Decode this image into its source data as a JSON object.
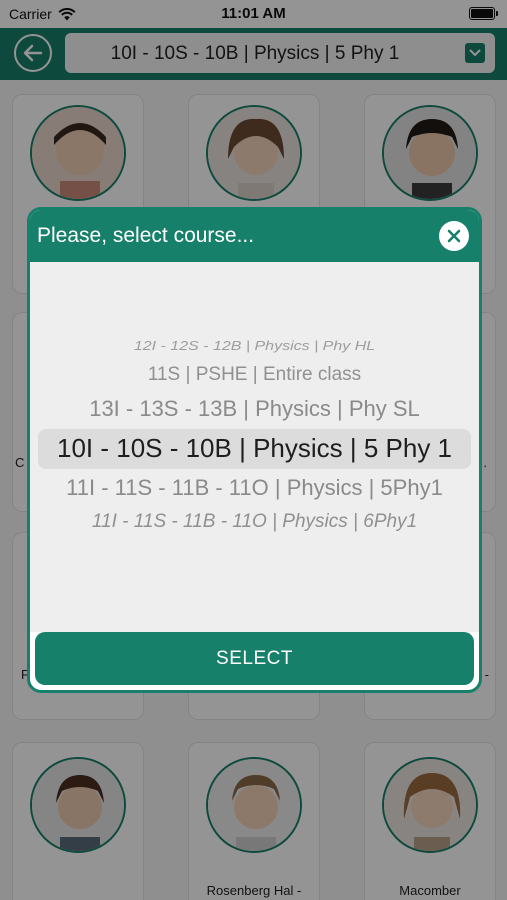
{
  "status_bar": {
    "carrier": "Carrier",
    "time": "11:01 AM"
  },
  "header": {
    "course_selected": "10I - 10S - 10B  | Physics | 5 Phy 1"
  },
  "students": [
    {
      "name": ""
    },
    {
      "name": ""
    },
    {
      "name": ""
    },
    {
      "name": "C"
    },
    {
      "name": ""
    },
    {
      "name": "."
    },
    {
      "name": "F"
    },
    {
      "name": ""
    },
    {
      "name": "-"
    },
    {
      "name": ""
    },
    {
      "name": "Rosenberg Hal -"
    },
    {
      "name": "Macomber"
    }
  ],
  "modal": {
    "title": "Please, select course...",
    "options": [
      "12I - 12S - 12B  | Physics | Phy HL",
      "11S  | PSHE | Entire class",
      "13I - 13S - 13B  | Physics | Phy SL",
      "10I - 10S - 10B  | Physics | 5 Phy 1",
      "11I - 11S - 11B - 11O  | Physics | 5Phy1",
      "11I - 11S - 11B - 11O  | Physics | 6Phy1"
    ],
    "select_label": "SELECT"
  },
  "colors": {
    "brand": "#17806a"
  }
}
